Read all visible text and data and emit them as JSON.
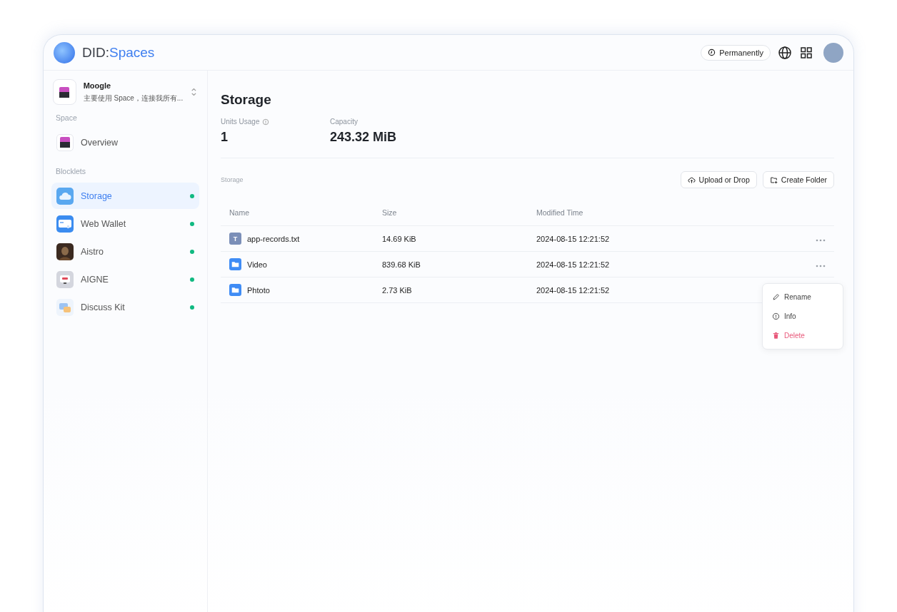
{
  "header": {
    "logo": {
      "first": "DID:",
      "second": "Spaces"
    },
    "plan_button": "Permanently"
  },
  "space": {
    "name": "Moogle",
    "description": "主要使用 Space，连接我所有..."
  },
  "sidebar": {
    "sections": [
      {
        "title": "Space",
        "items": [
          {
            "label": "Overview",
            "kind": "space",
            "selected": false
          }
        ]
      },
      {
        "title": "Blocklets",
        "items": [
          {
            "label": "Storage",
            "kind": "cloud",
            "selected": true,
            "color": "#10b981"
          },
          {
            "label": "Web Wallet",
            "kind": "wallet",
            "selected": false,
            "color": "#10b981"
          },
          {
            "label": "Aistro",
            "kind": "photo",
            "selected": false,
            "color": "#10b981"
          },
          {
            "label": "AIGNE",
            "kind": "device",
            "selected": false,
            "color": "#10b981"
          },
          {
            "label": "Discuss Kit",
            "kind": "chat",
            "selected": false,
            "color": "#10b981"
          }
        ]
      }
    ]
  },
  "main": {
    "title": "Storage",
    "stats": [
      {
        "label": "Units Usage",
        "value": "1",
        "info": true
      },
      {
        "label": "Capacity",
        "value": "243.32 MiB",
        "info": false
      }
    ],
    "section_label": "Storage",
    "buttons": [
      {
        "label": "Upload or Drop",
        "kind": "upload"
      },
      {
        "label": "Create Folder",
        "kind": "folder"
      }
    ],
    "table": {
      "columns": [
        "Name",
        "Size",
        "Modified Time"
      ],
      "rows": [
        {
          "name": "app-records.txt",
          "kind": "file",
          "type_letter": "T",
          "size": "14.69 KiB",
          "modified": "2024-08-15 12:21:52"
        },
        {
          "name": "Video",
          "kind": "folder",
          "size": "839.68 KiB",
          "modified": "2024-08-15 12:21:52"
        },
        {
          "name": "Phtoto",
          "kind": "folder",
          "size": "2.73 KiB",
          "modified": "2024-08-15 12:21:52"
        }
      ]
    },
    "context_menu": [
      {
        "label": "Rename",
        "kind": "edit"
      },
      {
        "label": "Info",
        "kind": "info"
      },
      {
        "label": "Delete",
        "kind": "danger"
      }
    ]
  }
}
